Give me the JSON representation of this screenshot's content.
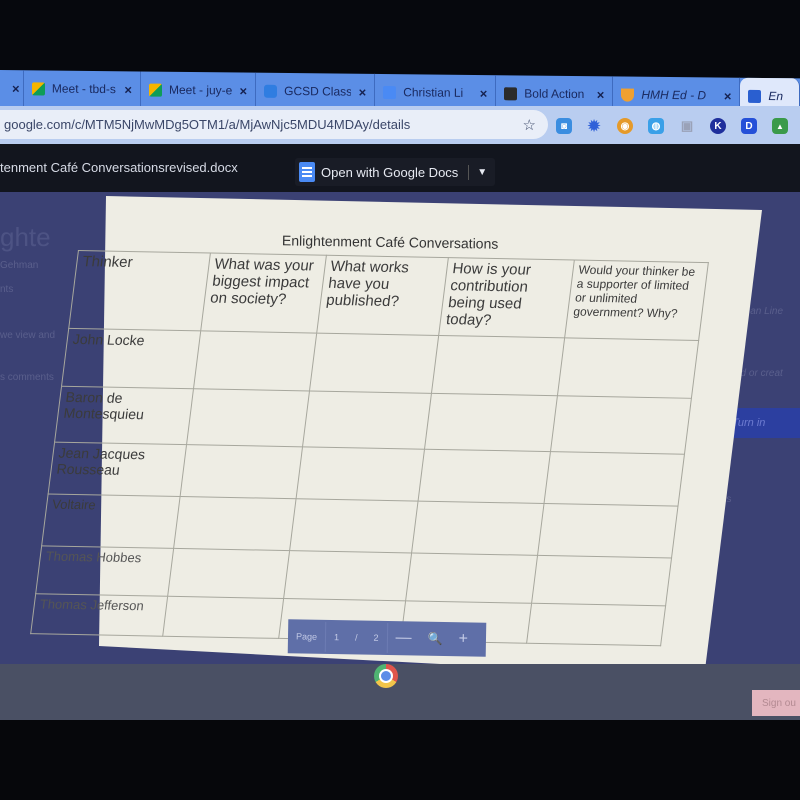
{
  "browser": {
    "tabs": [
      {
        "label": "",
        "icon": "tab-favicon",
        "color": "#f2f2f2"
      },
      {
        "label": "Meet - tbd-s",
        "icon": "google-meet-icon",
        "color": "#f4b400"
      },
      {
        "label": "Meet - juy-e",
        "icon": "google-meet-icon",
        "color": "#f4b400"
      },
      {
        "label": "GCSD Class",
        "icon": "cloud-icon",
        "color": "#2f7de1"
      },
      {
        "label": "Christian Li",
        "icon": "google-docs-icon",
        "color": "#4a8af4"
      },
      {
        "label": "Bold Action",
        "icon": "contact-icon",
        "color": "#2b2b2b"
      },
      {
        "label": "HMH Ed - D",
        "icon": "hmh-icon",
        "color": "#f0a030"
      },
      {
        "label": "En",
        "icon": "classroom-icon",
        "color": "#2a5fd0",
        "active": true
      }
    ],
    "tab_close_glyph": "×",
    "address_url": "google.com/c/MTM5NjMwMDg5OTM1/a/MjAwNjc5MDU4MDAy/details",
    "bookmark_glyph": "☆",
    "extensions": [
      {
        "name": "cloud-extension-icon",
        "glyph": "◙",
        "color": "#3a8de0"
      },
      {
        "name": "sun-extension-icon",
        "glyph": "✹",
        "color": "#3060d8"
      },
      {
        "name": "compass-extension-icon",
        "glyph": "◉",
        "color": "#e59a2a"
      },
      {
        "name": "globe-extension-icon",
        "glyph": "◍",
        "color": "#3aa0e8"
      },
      {
        "name": "puzzle-extension-icon",
        "glyph": "▣",
        "color": "#9aa2b8"
      },
      {
        "name": "k-extension-icon",
        "glyph": "K",
        "color": "#1f2f9c"
      },
      {
        "name": "d-extension-icon",
        "glyph": "D",
        "color": "#2550d8"
      },
      {
        "name": "classroom-extension-icon",
        "glyph": "▲",
        "color": "#3a9a4a"
      }
    ]
  },
  "viewer": {
    "filename": "tenment Café Conversationsrevised.docx",
    "open_with_label": "Open with Google Docs",
    "dropdown_glyph": "▼"
  },
  "background": {
    "title_fragment": "ghte",
    "author_fragment": "Gehman",
    "points_fragment": "nts",
    "instructions_fragment": "we view and",
    "comments_fragment": "s comments",
    "right_link_fragment": "ian Line",
    "add_create_fragment": "dd or creat",
    "turn_in_label": "Turn in",
    "right_comments_fragment": "nts",
    "sign_out_label": "Sign ou"
  },
  "document": {
    "title": "Enlightenment Café Conversations",
    "headers": [
      "Thinker",
      "What was your biggest impact on society?",
      "What works have you published?",
      "How is your contribution being used today?",
      "Would your thinker be a supporter of limited or unlimited government?  Why?"
    ],
    "thinkers": [
      "John Locke",
      "Baron de Montesquieu",
      "Jean Jacques Rousseau",
      "Voltaire",
      "Thomas Hobbes",
      "Thomas Jefferson"
    ]
  },
  "page_control": {
    "page_label": "Page",
    "current_page": "1",
    "separator": "/",
    "total_pages": "2",
    "zoom_out_glyph": "—",
    "zoom_glyph": "🔍",
    "zoom_in_glyph": "+"
  }
}
